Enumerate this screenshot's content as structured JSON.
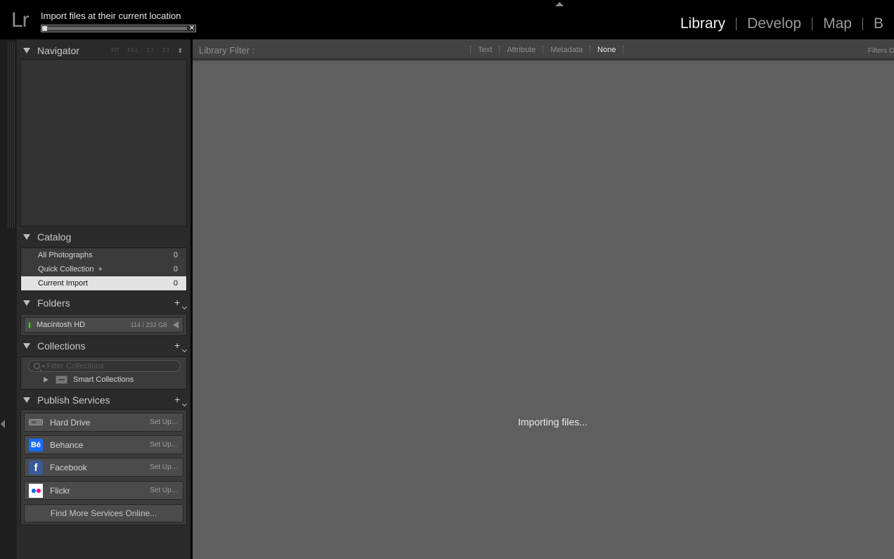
{
  "app": {
    "logo": "Lr"
  },
  "import": {
    "title": "Import files at their current location",
    "close_symbol": "✕",
    "progress_percent": 3
  },
  "modules": [
    "Library",
    "Develop",
    "Map",
    "B"
  ],
  "navigator": {
    "title": "Navigator",
    "zoom_options": [
      "FIT",
      "FILL",
      "1:1",
      "3:1"
    ],
    "zoom_stepper": "⬍"
  },
  "catalog": {
    "title": "Catalog",
    "items": [
      {
        "label": "All Photographs",
        "count": "0"
      },
      {
        "label": "Quick Collection",
        "plus": "+",
        "count": "0"
      },
      {
        "label": "Current Import",
        "count": "0",
        "selected": true
      }
    ]
  },
  "folders": {
    "title": "Folders",
    "add": "+",
    "volume": {
      "name": "Macintosh HD",
      "size": "114 / 233 GB"
    }
  },
  "collections": {
    "title": "Collections",
    "add": "+",
    "filter_placeholder": "Filter Collections",
    "filter_caret": "▾",
    "smart": "Smart Collections"
  },
  "publish": {
    "title": "Publish Services",
    "add": "+",
    "services": [
      {
        "name": "Hard Drive",
        "action": "Set Up...",
        "icon": "hard-drive-icon"
      },
      {
        "name": "Behance",
        "action": "Set Up...",
        "icon": "behance-icon",
        "icon_text": "Bē"
      },
      {
        "name": "Facebook",
        "action": "Set Up...",
        "icon": "facebook-icon",
        "icon_text": "f"
      },
      {
        "name": "Flickr",
        "action": "Set Up...",
        "icon": "flickr-icon"
      }
    ],
    "find_more": "Find More Services Online..."
  },
  "filter_bar": {
    "label": "Library Filter :",
    "options": [
      "Text",
      "Attribute",
      "Metadata",
      "None"
    ],
    "active": "None",
    "filters_off": "Filters Off"
  },
  "main": {
    "status": "Importing files..."
  },
  "colors": {
    "behance": "#1769ff",
    "facebook": "#3b5998",
    "flickr_blue": "#0063dc",
    "flickr_pink": "#ff0084",
    "drive_led": "#5fbf4a",
    "selected_row": "#e2e2e2"
  }
}
